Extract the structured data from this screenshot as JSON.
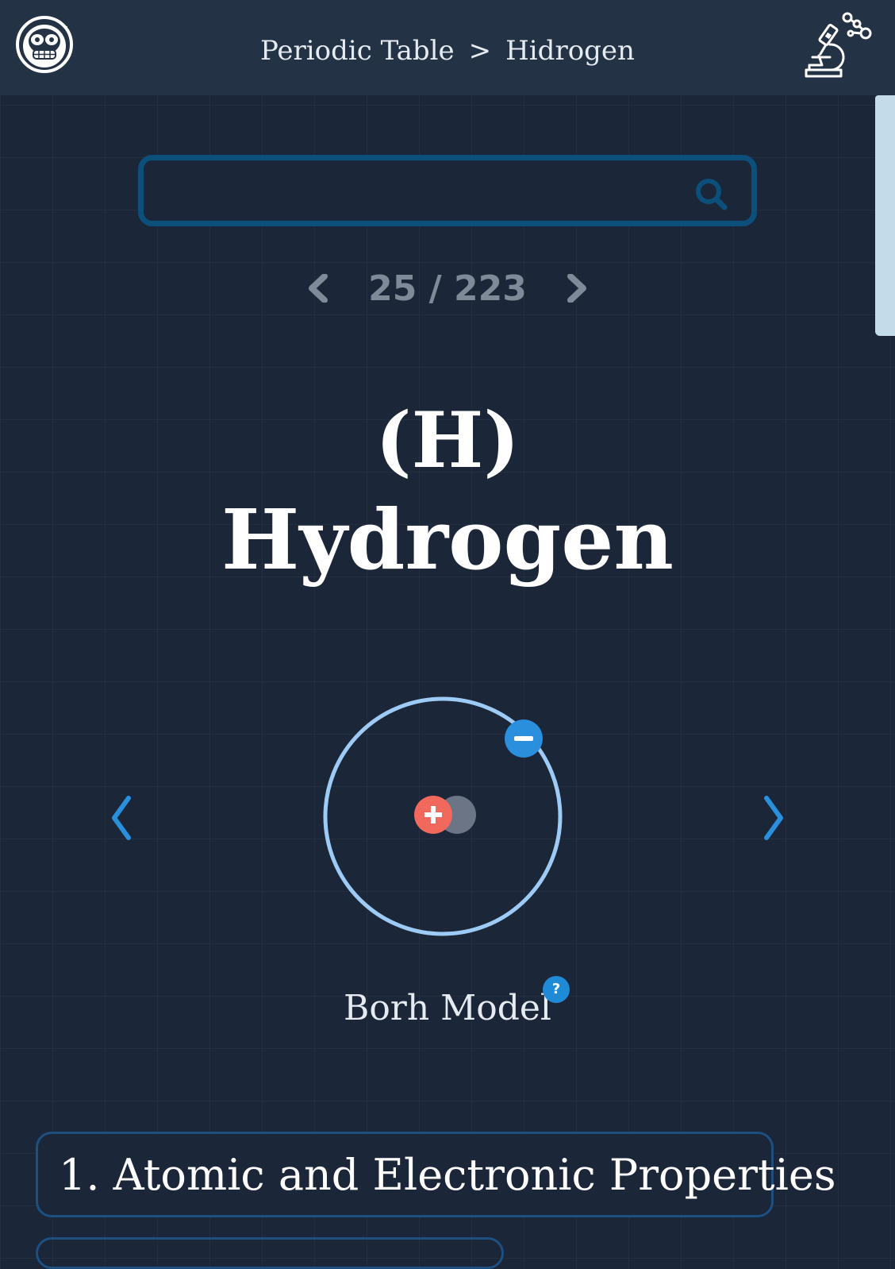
{
  "header": {
    "breadcrumb_root": "Periodic Table",
    "breadcrumb_separator": ">",
    "breadcrumb_current": "Hidrogen",
    "logo_icon": "monkey-astronaut-icon",
    "right_icon": "microscope-molecule-icon"
  },
  "search": {
    "value": "",
    "placeholder": "",
    "icon": "search-icon"
  },
  "pager": {
    "count": "25 / 223",
    "current": 25,
    "total": 223
  },
  "element": {
    "symbol": "(H)",
    "name": "Hydrogen"
  },
  "model": {
    "label": "Borh Model",
    "help": "?",
    "proton_color": "#f0695c",
    "neutron_color": "#6b7585",
    "electron_color": "#2a8fdc",
    "orbit_color": "#9ecbf5"
  },
  "sections": [
    {
      "title": "1. Atomic and Electronic Properties"
    }
  ],
  "colors": {
    "background": "#1b2638",
    "topbar": "#243246",
    "accent": "#2a8fdc",
    "search_border": "#0c4f7a"
  }
}
